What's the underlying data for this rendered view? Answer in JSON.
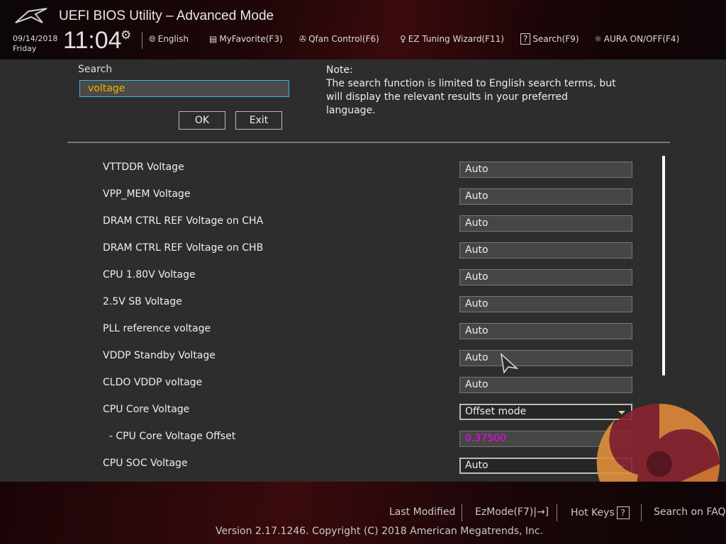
{
  "header": {
    "title": "UEFI BIOS Utility – Advanced Mode",
    "date": "09/14/2018",
    "day": "Friday",
    "time": "11:04",
    "toolbar": [
      {
        "icon": "globe-icon",
        "label": "English"
      },
      {
        "icon": "favorite-icon",
        "label": "MyFavorite(F3)"
      },
      {
        "icon": "fan-icon",
        "label": "Qfan Control(F6)"
      },
      {
        "icon": "bulb-icon",
        "label": "EZ Tuning Wizard(F11)"
      },
      {
        "icon": "help-icon",
        "label": "Search(F9)"
      },
      {
        "icon": "aura-icon",
        "label": "AURA ON/OFF(F4)"
      }
    ]
  },
  "search": {
    "label": "Search",
    "value": "voltage",
    "ok": "OK",
    "exit": "Exit",
    "note_title": "Note:",
    "note": "The search function is limited to English search terms, but will display the relevant results in your preferred language."
  },
  "rows": [
    {
      "label": "VTTDDR Voltage",
      "value": "Auto"
    },
    {
      "label": "VPP_MEM Voltage",
      "value": "Auto"
    },
    {
      "label": "DRAM CTRL REF Voltage on CHA",
      "value": "Auto"
    },
    {
      "label": "DRAM CTRL REF Voltage on CHB",
      "value": "Auto"
    },
    {
      "label": "CPU 1.80V Voltage",
      "value": "Auto"
    },
    {
      "label": "2.5V SB Voltage",
      "value": "Auto"
    },
    {
      "label": "PLL reference voltage",
      "value": "Auto"
    },
    {
      "label": "VDDP Standby Voltage",
      "value": "Auto"
    },
    {
      "label": "CLDO VDDP voltage",
      "value": "Auto"
    },
    {
      "label": "CPU Core Voltage",
      "value": "Offset mode"
    },
    {
      "label": "  - CPU Core Voltage Offset",
      "value": "0.37500"
    },
    {
      "label": "CPU SOC Voltage",
      "value": "Auto"
    }
  ],
  "footer": {
    "last_modified": "Last Modified",
    "ezmode": "EzMode(F7)|→]",
    "hotkeys": "Hot Keys",
    "hotkeys_icon": "?",
    "faq": "Search on FAQ",
    "version": "Version 2.17.1246. Copyright (C) 2018 American Megatrends, Inc."
  },
  "colors": {
    "search_text": "#f0b400",
    "offset_value": "#ff00ff",
    "input_border": "#3bb8d8"
  }
}
